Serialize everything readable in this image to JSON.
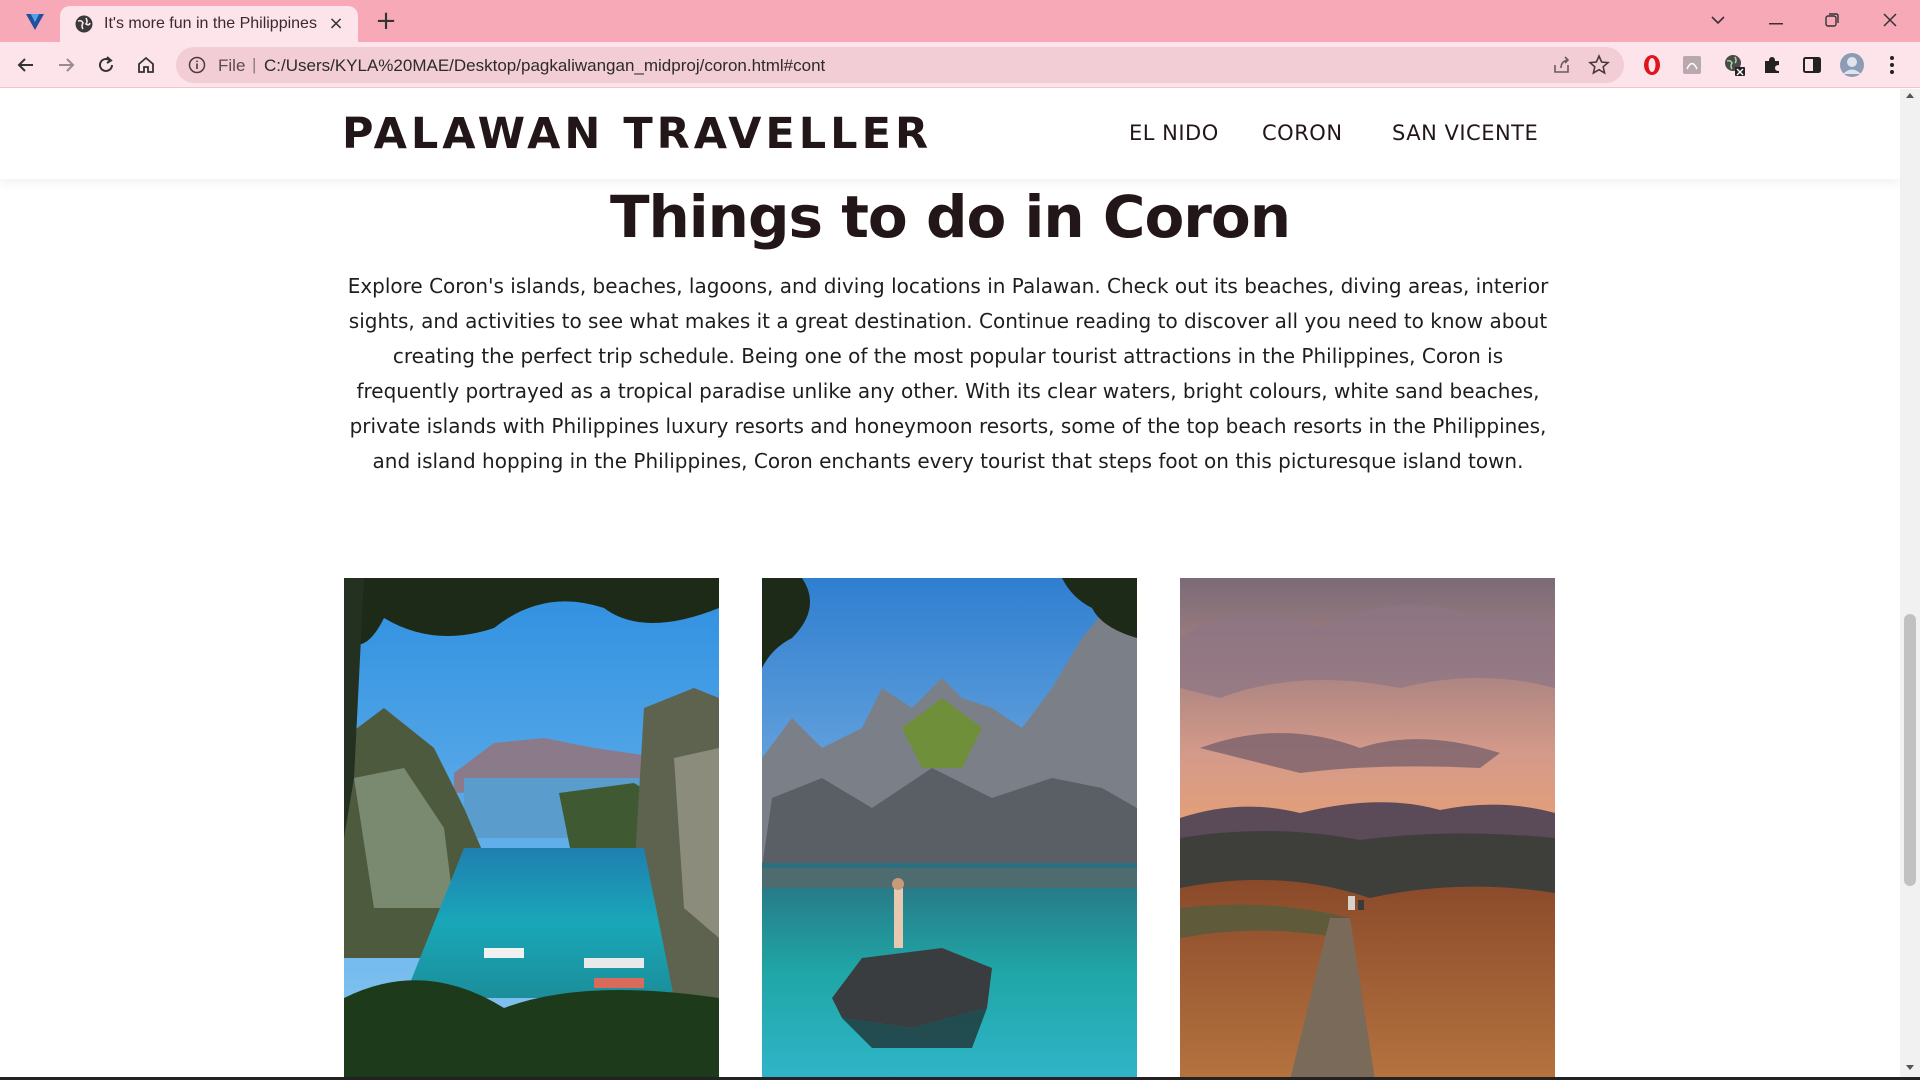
{
  "browser": {
    "tab_title": "It's more fun in the Philippines",
    "tab_close": "×",
    "new_tab": "+",
    "address_scheme": "File",
    "address_separator": "|",
    "address_url": "C:/Users/KYLA%20MAE/Desktop/pagkaliwangan_midproj/coron.html#cont",
    "window_controls": {
      "chevron": "⌄",
      "minimize": "—",
      "restore": "❐",
      "close": "✕"
    },
    "colors": {
      "tabstrip": "#f7a9b8",
      "toolbar": "#fde4ea",
      "omnibox": "#f3cdd6"
    }
  },
  "site": {
    "brand": "PALAWAN TRAVELLER",
    "nav": [
      {
        "label": "EL NIDO"
      },
      {
        "label": "CORON"
      },
      {
        "label": "SAN VICENTE"
      }
    ]
  },
  "main": {
    "headline": "Things to do in Coron",
    "intro": "Explore Coron's islands, beaches, lagoons, and diving locations in Palawan. Check out its beaches, diving areas, interior sights, and activities to see what makes it a great destination. Continue reading to discover all you need to know about creating the perfect trip schedule. Being one of the most popular tourist attractions in the Philippines, Coron is frequently portrayed as a tropical paradise unlike any other. With its clear waters, bright colours, white sand beaches, private islands with Philippines luxury resorts and honeymoon resorts, some of the top beach resorts in the Philippines, and island hopping in the Philippines, Coron enchants every tourist that steps foot on this picturesque island town."
  }
}
